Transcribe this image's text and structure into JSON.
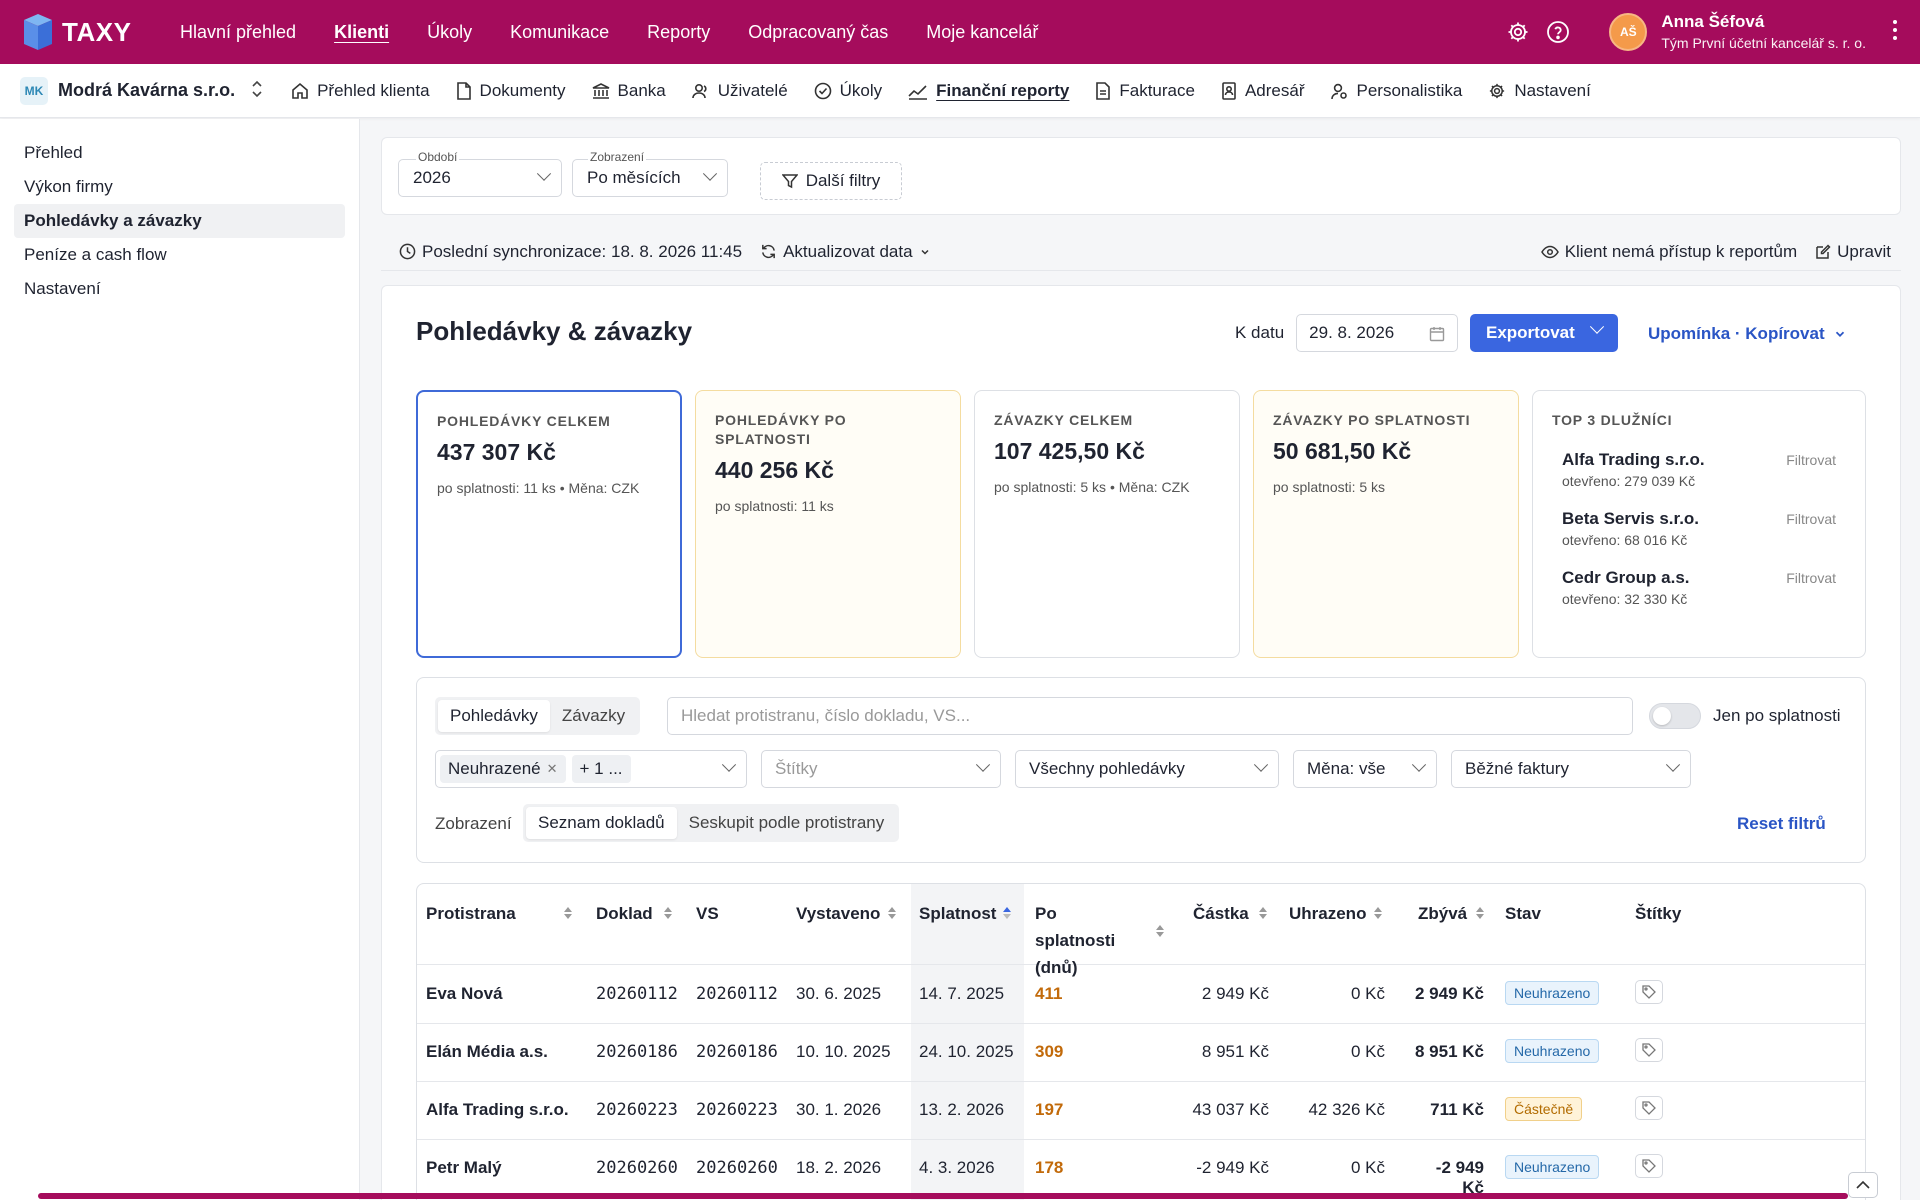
{
  "app": {
    "logo": "TAXY"
  },
  "topnav": [
    "Hlavní přehled",
    "Klienti",
    "Úkoly",
    "Komunikace",
    "Reporty",
    "Odpracovaný čas",
    "Moje kancelář"
  ],
  "user": {
    "initials": "AŠ",
    "name": "Anna Šéfová",
    "team": "Tým První účetní kancelář s. r. o."
  },
  "client": {
    "badge": "MK",
    "name": "Modrá Kavárna s.r.o."
  },
  "subnav": [
    "Přehled klienta",
    "Dokumenty",
    "Banka",
    "Uživatelé",
    "Úkoly",
    "Finanční reporty",
    "Fakturace",
    "Adresář",
    "Personalistika",
    "Nastavení"
  ],
  "sidebar": [
    "Přehled",
    "Výkon firmy",
    "Pohledávky a závazky",
    "Peníze a cash flow",
    "Nastavení"
  ],
  "filters": {
    "period_label": "Období",
    "period_value": "2026",
    "view_label": "Zobrazení",
    "view_value": "Po měsících",
    "more": "Další filtry"
  },
  "sync": {
    "text": "Poslední synchronizace: 18. 8. 2026 11:45",
    "refresh": "Aktualizovat data",
    "access": "Klient nemá přístup k reportům",
    "edit": "Upravit"
  },
  "panel": {
    "title": "Pohledávky & závazky",
    "date_label": "K datu",
    "date_value": "29. 8. 2026",
    "export": "Exportovat",
    "reminder": "Upomínka · Kopírovat"
  },
  "cards": [
    {
      "title": "Pohledávky celkem",
      "value": "437 307 Kč",
      "sub": "po splatnosti: 11 ks • Měna: CZK"
    },
    {
      "title": "Pohledávky po splatnosti",
      "value": "440 256 Kč",
      "sub": "po splatnosti: 11 ks"
    },
    {
      "title": "Závazky celkem",
      "value": "107 425,50 Kč",
      "sub": "po splatnosti: 5 ks • Měna: CZK"
    },
    {
      "title": "Závazky po splatnosti",
      "value": "50 681,50 Kč",
      "sub": "po splatnosti: 5 ks"
    }
  ],
  "top3": {
    "title": "Top 3 dlužníci",
    "filter_label": "Filtrovat",
    "items": [
      {
        "name": "Alfa Trading s.r.o.",
        "open": "otevřeno: 279 039 Kč"
      },
      {
        "name": "Beta Servis s.r.o.",
        "open": "otevřeno: 68 016 Kč"
      },
      {
        "name": "Cedr Group a.s.",
        "open": "otevřeno: 32 330 Kč"
      }
    ]
  },
  "tablefilters": {
    "tab_receivables": "Pohledávky",
    "tab_payables": "Závazky",
    "search_placeholder": "Hledat protistranu, číslo dokladu, VS...",
    "overdue_only": "Jen po splatnosti",
    "chip_status": "Neuhrazené",
    "chip_more": "+ 1 ...",
    "tags_placeholder": "Štítky",
    "scope": "Všechny pohledávky",
    "currency": "Měna: vše",
    "invoice_type": "Běžné faktury",
    "view_label": "Zobrazení",
    "view_list": "Seznam dokladů",
    "view_grouped": "Seskupit podle protistrany",
    "reset": "Reset filtrů"
  },
  "table": {
    "headers": [
      "Protistrana",
      "Doklad",
      "VS",
      "Vystaveno",
      "Splatnost",
      "Po splatnosti (dnů)",
      "Částka",
      "Uhrazeno",
      "Zbývá",
      "Stav",
      "Štítky"
    ],
    "rows": [
      {
        "party": "Eva Nová",
        "doc": "20260112",
        "vs": "20260112",
        "issued": "30. 6. 2025",
        "due": "14. 7. 2025",
        "days": "411",
        "amount": "2 949 Kč",
        "paid": "0 Kč",
        "left": "2 949 Kč",
        "status": "Neuhrazeno"
      },
      {
        "party": "Elán Média a.s.",
        "doc": "20260186",
        "vs": "20260186",
        "issued": "10. 10. 2025",
        "due": "24. 10. 2025",
        "days": "309",
        "amount": "8 951 Kč",
        "paid": "0 Kč",
        "left": "8 951 Kč",
        "status": "Neuhrazeno"
      },
      {
        "party": "Alfa Trading s.r.o.",
        "doc": "20260223",
        "vs": "20260223",
        "issued": "30. 1. 2026",
        "due": "13. 2. 2026",
        "days": "197",
        "amount": "43 037 Kč",
        "paid": "42 326 Kč",
        "left": "711 Kč",
        "status": "Částečně"
      },
      {
        "party": "Petr Malý",
        "doc": "20260260",
        "vs": "20260260",
        "issued": "18. 2. 2026",
        "due": "4. 3. 2026",
        "days": "178",
        "amount": "-2 949 Kč",
        "paid": "0 Kč",
        "left": "-2 949 Kč",
        "status": "Neuhrazeno"
      }
    ]
  },
  "colors": {
    "brand": "#a50c5c",
    "accent": "#3a66e0",
    "link": "#2a55c5",
    "overdue": "#c26a0a"
  }
}
